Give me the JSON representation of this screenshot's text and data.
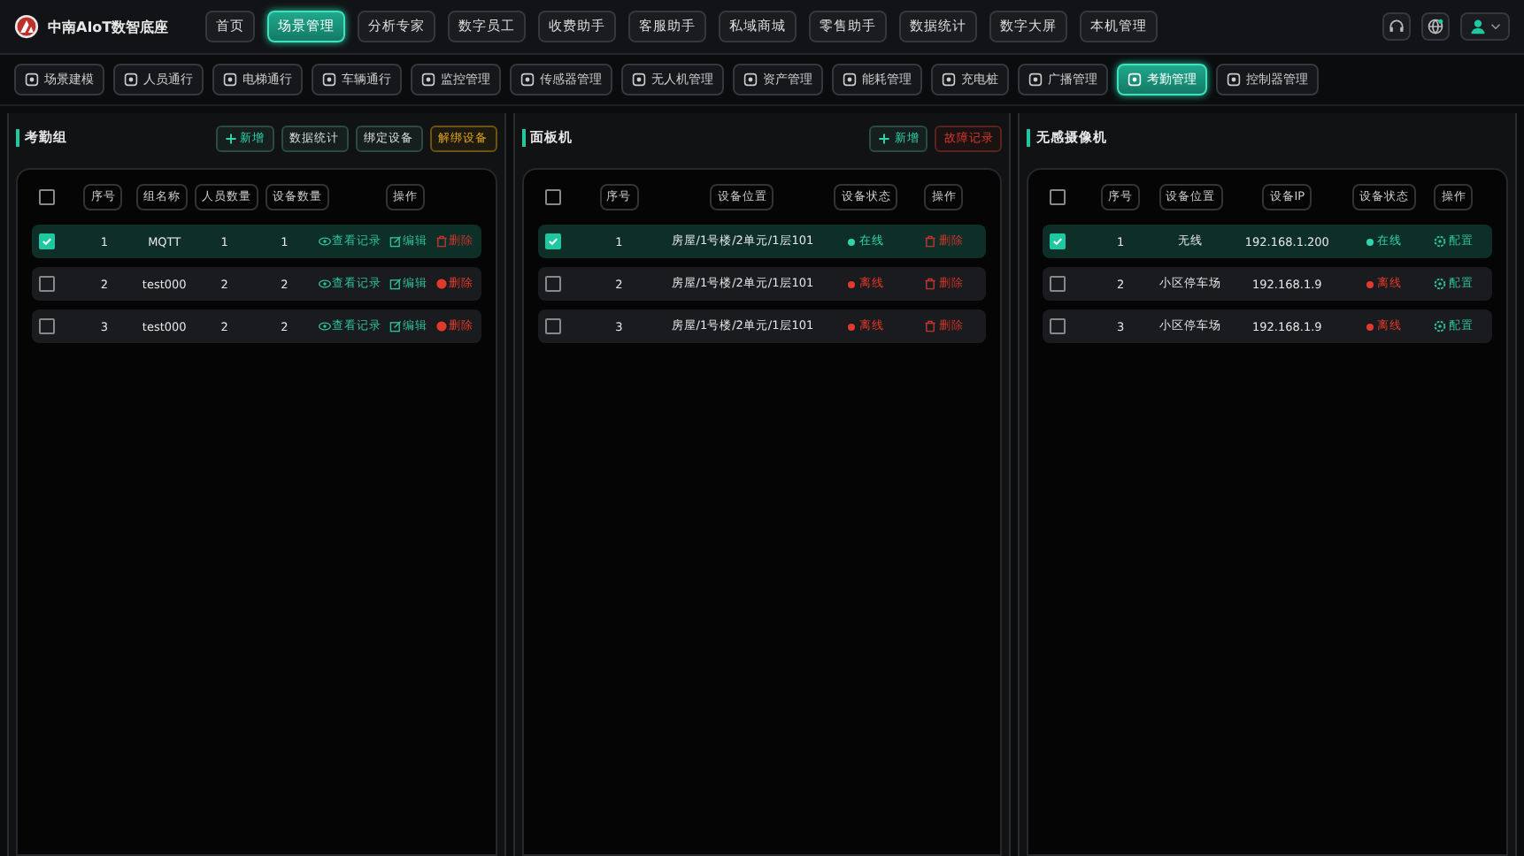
{
  "app": {
    "title": "中南AIoT数智底座"
  },
  "nav": [
    {
      "label": "首页",
      "selected": false
    },
    {
      "label": "场景管理",
      "selected": true
    },
    {
      "label": "分析专家",
      "selected": false
    },
    {
      "label": "数字员工",
      "selected": false
    },
    {
      "label": "收费助手",
      "selected": false
    },
    {
      "label": "客服助手",
      "selected": false
    },
    {
      "label": "私域商城",
      "selected": false
    },
    {
      "label": "零售助手",
      "selected": false
    },
    {
      "label": "数据统计",
      "selected": false
    },
    {
      "label": "数字大屏",
      "selected": false
    },
    {
      "label": "本机管理",
      "selected": false
    }
  ],
  "subnav": [
    {
      "label": "场景建模",
      "selected": false
    },
    {
      "label": "人员通行",
      "selected": false
    },
    {
      "label": "电梯通行",
      "selected": false
    },
    {
      "label": "车辆通行",
      "selected": false
    },
    {
      "label": "监控管理",
      "selected": false
    },
    {
      "label": "传感器管理",
      "selected": false
    },
    {
      "label": "无人机管理",
      "selected": false
    },
    {
      "label": "资产管理",
      "selected": false
    },
    {
      "label": "能耗管理",
      "selected": false
    },
    {
      "label": "充电桩",
      "selected": false
    },
    {
      "label": "广播管理",
      "selected": false
    },
    {
      "label": "考勤管理",
      "selected": true
    },
    {
      "label": "控制器管理",
      "selected": false
    }
  ],
  "panels": [
    {
      "title": "考勤组",
      "all_selected": false,
      "buttons": [
        {
          "label": "新增",
          "kind": "add"
        },
        {
          "label": "数据统计",
          "kind": "normal"
        },
        {
          "label": "绑定设备",
          "kind": "normal"
        },
        {
          "label": "解绑设备",
          "kind": "warn"
        }
      ],
      "columns": [
        "序号",
        "组名称",
        "人员数量",
        "设备数量",
        "操作"
      ],
      "rows": [
        {
          "selected": true,
          "cells": [
            {
              "kind": "text",
              "text": "1"
            },
            {
              "kind": "text",
              "text": "MQTT"
            },
            {
              "kind": "text",
              "text": "1"
            },
            {
              "kind": "text",
              "text": "1"
            },
            {
              "kind": "actions",
              "actions": [
                {
                  "kind": "view",
                  "label": "查看记录"
                },
                {
                  "kind": "edit",
                  "label": "编辑"
                },
                {
                  "kind": "delete",
                  "label": "删除"
                }
              ]
            }
          ]
        },
        {
          "selected": false,
          "cells": [
            {
              "kind": "text",
              "text": "2"
            },
            {
              "kind": "text",
              "text": "test000"
            },
            {
              "kind": "text",
              "text": "2"
            },
            {
              "kind": "text",
              "text": "2"
            },
            {
              "kind": "actions",
              "actions": [
                {
                  "kind": "view",
                  "label": "查看记录"
                },
                {
                  "kind": "edit",
                  "label": "编辑"
                },
                {
                  "kind": "unbind",
                  "label": "删除"
                }
              ]
            }
          ]
        },
        {
          "selected": false,
          "cells": [
            {
              "kind": "text",
              "text": "3"
            },
            {
              "kind": "text",
              "text": "test000"
            },
            {
              "kind": "text",
              "text": "2"
            },
            {
              "kind": "text",
              "text": "2"
            },
            {
              "kind": "actions",
              "actions": [
                {
                  "kind": "view",
                  "label": "查看记录"
                },
                {
                  "kind": "edit",
                  "label": "编辑"
                },
                {
                  "kind": "unbind",
                  "label": "删除"
                }
              ]
            }
          ]
        }
      ]
    },
    {
      "title": "面板机",
      "all_selected": false,
      "buttons": [
        {
          "label": "新增",
          "kind": "add"
        },
        {
          "label": "故障记录",
          "kind": "danger"
        }
      ],
      "columns": [
        "序号",
        "设备位置",
        "设备状态",
        "操作"
      ],
      "rows": [
        {
          "selected": true,
          "cells": [
            {
              "kind": "text",
              "text": "1"
            },
            {
              "kind": "text",
              "text": "房屋/1号楼/2单元/1层101"
            },
            {
              "kind": "status",
              "text": "在线",
              "online": true
            },
            {
              "kind": "actions",
              "actions": [
                {
                  "kind": "delete",
                  "label": "删除"
                }
              ]
            }
          ]
        },
        {
          "selected": false,
          "cells": [
            {
              "kind": "text",
              "text": "2"
            },
            {
              "kind": "text",
              "text": "房屋/1号楼/2单元/1层101"
            },
            {
              "kind": "status",
              "text": "离线",
              "online": false
            },
            {
              "kind": "actions",
              "actions": [
                {
                  "kind": "delete",
                  "label": "删除"
                }
              ]
            }
          ]
        },
        {
          "selected": false,
          "cells": [
            {
              "kind": "text",
              "text": "3"
            },
            {
              "kind": "text",
              "text": "房屋/1号楼/2单元/1层101"
            },
            {
              "kind": "status",
              "text": "离线",
              "online": false
            },
            {
              "kind": "actions",
              "actions": [
                {
                  "kind": "delete",
                  "label": "删除"
                }
              ]
            }
          ]
        }
      ]
    },
    {
      "title": "无感摄像机",
      "all_selected": false,
      "columns": [
        "序号",
        "设备位置",
        "设备IP",
        "设备状态",
        "操作"
      ],
      "rows": [
        {
          "selected": true,
          "cells": [
            {
              "kind": "text",
              "text": "1"
            },
            {
              "kind": "text",
              "text": "无线"
            },
            {
              "kind": "text",
              "text": "192.168.1.200"
            },
            {
              "kind": "status",
              "text": "在线",
              "online": true
            },
            {
              "kind": "actions",
              "actions": [
                {
                  "kind": "config",
                  "label": "配置"
                }
              ]
            }
          ]
        },
        {
          "selected": false,
          "cells": [
            {
              "kind": "text",
              "text": "2"
            },
            {
              "kind": "text",
              "text": "小区停车场"
            },
            {
              "kind": "text",
              "text": "192.168.1.9"
            },
            {
              "kind": "status",
              "text": "离线",
              "online": false
            },
            {
              "kind": "actions",
              "actions": [
                {
                  "kind": "config",
                  "label": "配置"
                }
              ]
            }
          ]
        },
        {
          "selected": false,
          "cells": [
            {
              "kind": "text",
              "text": "3"
            },
            {
              "kind": "text",
              "text": "小区停车场"
            },
            {
              "kind": "text",
              "text": "192.168.1.9"
            },
            {
              "kind": "status",
              "text": "离线",
              "online": false
            },
            {
              "kind": "actions",
              "actions": [
                {
                  "kind": "config",
                  "label": "配置"
                }
              ]
            }
          ]
        }
      ]
    }
  ]
}
